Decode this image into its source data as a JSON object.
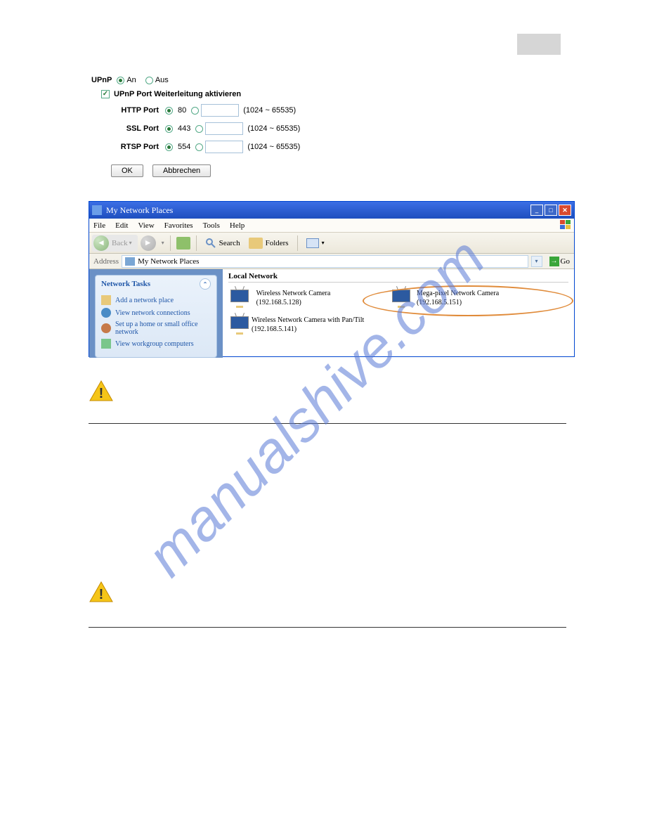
{
  "upnp": {
    "title": "UPnP",
    "on": "An",
    "off": "Aus",
    "forward_label": "UPnP Port Weiterleitung aktivieren",
    "ports": {
      "http": {
        "label": "HTTP Port",
        "default": "80",
        "range": "(1024 ~ 65535)"
      },
      "ssl": {
        "label": "SSL Port",
        "default": "443",
        "range": "(1024 ~ 65535)"
      },
      "rtsp": {
        "label": "RTSP Port",
        "default": "554",
        "range": "(1024 ~ 65535)"
      }
    },
    "ok": "OK",
    "cancel": "Abbrechen"
  },
  "window": {
    "title": "My Network Places",
    "menu": {
      "file": "File",
      "edit": "Edit",
      "view": "View",
      "favorites": "Favorites",
      "tools": "Tools",
      "help": "Help"
    },
    "toolbar": {
      "back": "Back",
      "search": "Search",
      "folders": "Folders"
    },
    "address_label": "Address",
    "address_value": "My Network Places",
    "go": "Go",
    "tasks": {
      "header": "Network Tasks",
      "items": [
        "Add a network place",
        "View network connections",
        "Set up a home or small office network",
        "View workgroup computers"
      ]
    },
    "section": "Local Network",
    "devices": [
      {
        "name": "Wireless Network Camera (192.168.5.128)"
      },
      {
        "name": "Mega-pixel Network Camera (192.168.5.151)"
      },
      {
        "name": "Wireless Network Camera with Pan/Tilt (192.168.5.141)"
      }
    ]
  },
  "watermark": "manualshive.com"
}
